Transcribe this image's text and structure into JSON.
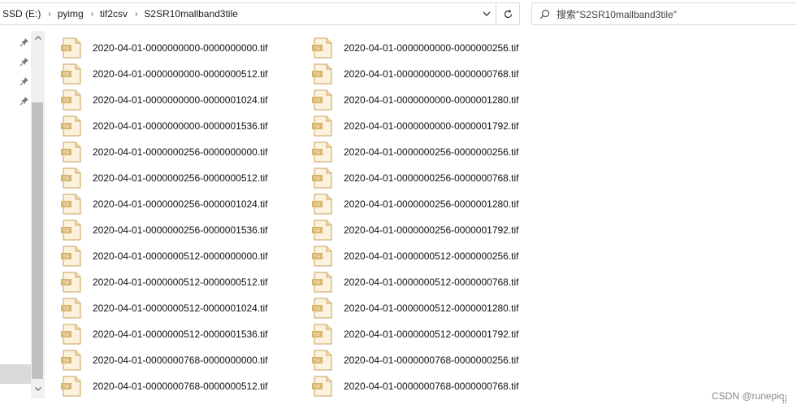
{
  "address_bar": {
    "breadcrumbs": [
      "SSD (E:)",
      "pyimg",
      "tif2csv",
      "S2SR10mallband3tile"
    ],
    "separator": "›"
  },
  "search": {
    "placeholder": "搜索\"S2SR10mallband3tile\""
  },
  "files": [
    "2020-04-01-0000000000-0000000000.tif",
    "2020-04-01-0000000000-0000000256.tif",
    "2020-04-01-0000000000-0000000512.tif",
    "2020-04-01-0000000000-0000000768.tif",
    "2020-04-01-0000000000-0000001024.tif",
    "2020-04-01-0000000000-0000001280.tif",
    "2020-04-01-0000000000-0000001536.tif",
    "2020-04-01-0000000000-0000001792.tif",
    "2020-04-01-0000000256-0000000000.tif",
    "2020-04-01-0000000256-0000000256.tif",
    "2020-04-01-0000000256-0000000512.tif",
    "2020-04-01-0000000256-0000000768.tif",
    "2020-04-01-0000000256-0000001024.tif",
    "2020-04-01-0000000256-0000001280.tif",
    "2020-04-01-0000000256-0000001536.tif",
    "2020-04-01-0000000256-0000001792.tif",
    "2020-04-01-0000000512-0000000000.tif",
    "2020-04-01-0000000512-0000000256.tif",
    "2020-04-01-0000000512-0000000512.tif",
    "2020-04-01-0000000512-0000000768.tif",
    "2020-04-01-0000000512-0000001024.tif",
    "2020-04-01-0000000512-0000001280.tif",
    "2020-04-01-0000000512-0000001536.tif",
    "2020-04-01-0000000512-0000001792.tif",
    "2020-04-01-0000000768-0000000000.tif",
    "2020-04-01-0000000768-0000000256.tif",
    "2020-04-01-0000000768-0000000512.tif",
    "2020-04-01-0000000768-0000000768.tif"
  ],
  "watermark": "CSDN @runepic",
  "icons": {
    "file": "tif-file-icon",
    "pin": "pin-icon",
    "search": "search-icon",
    "refresh": "refresh-icon",
    "dropdown": "chevron-down-icon"
  },
  "colors": {
    "border": "#d9d9d9",
    "scroll_thumb": "#c1c1c1",
    "file_icon_fill": "#fbf1dc",
    "file_icon_stroke": "#c9a15a"
  }
}
